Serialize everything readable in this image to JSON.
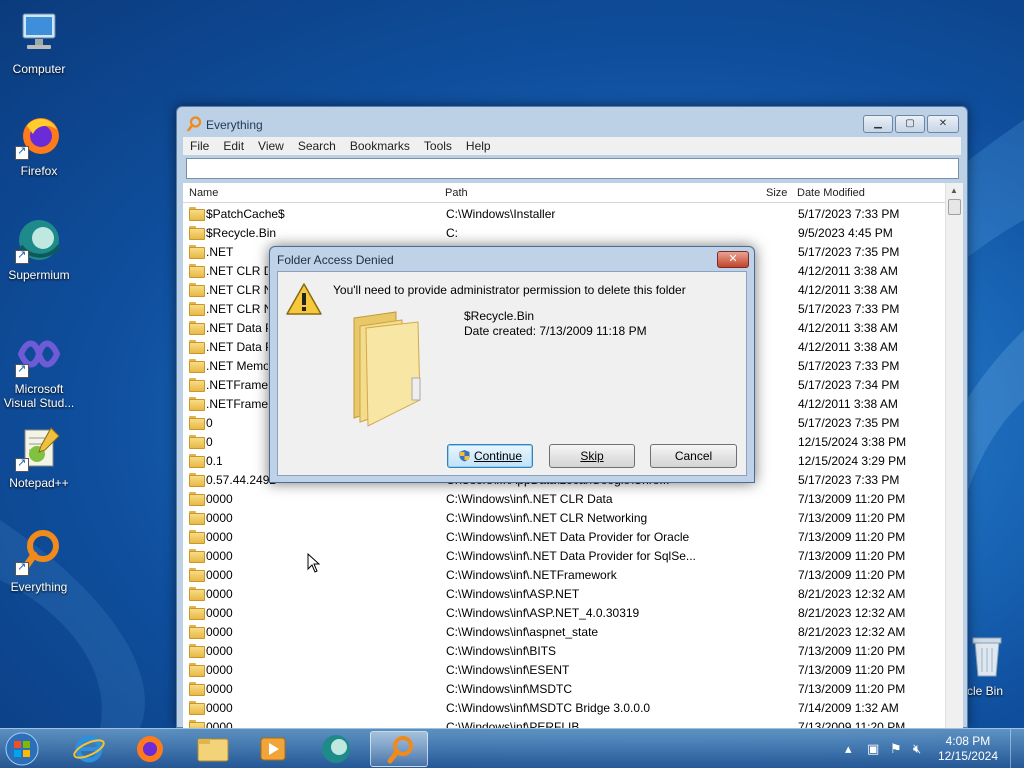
{
  "desktop": {
    "icons": [
      {
        "label": "Computer"
      },
      {
        "label": "Firefox"
      },
      {
        "label": "Supermium"
      },
      {
        "label": "Microsoft Visual Stud..."
      },
      {
        "label": "Notepad++"
      },
      {
        "label": "Everything"
      },
      {
        "label": "cle Bin"
      }
    ]
  },
  "window": {
    "title": "Everything",
    "menu": [
      "File",
      "Edit",
      "View",
      "Search",
      "Bookmarks",
      "Tools",
      "Help"
    ],
    "search_value": "",
    "columns": {
      "name": "Name",
      "path": "Path",
      "size": "Size",
      "date": "Date Modified"
    },
    "rows": [
      {
        "name": "$PatchCache$",
        "path": "C:\\Windows\\Installer",
        "date": "5/17/2023 7:33 PM"
      },
      {
        "name": "$Recycle.Bin",
        "path": "C:",
        "date": "9/5/2023 4:45 PM"
      },
      {
        "name": ".NET",
        "path": "",
        "date": "5/17/2023 7:35 PM"
      },
      {
        "name": ".NET CLR Da",
        "path": "",
        "date": "4/12/2011 3:38 AM"
      },
      {
        "name": ".NET CLR Ne",
        "path": "",
        "date": "4/12/2011 3:38 AM"
      },
      {
        "name": ".NET CLR Ne",
        "path": "",
        "date": "5/17/2023 7:33 PM"
      },
      {
        "name": ".NET Data Pr",
        "path": "",
        "date": "4/12/2011 3:38 AM"
      },
      {
        "name": ".NET Data Pr",
        "path": "",
        "date": "4/12/2011 3:38 AM"
      },
      {
        "name": ".NET Memo",
        "path": "",
        "date": "5/17/2023 7:33 PM"
      },
      {
        "name": ".NETFramew",
        "path": "",
        "date": "5/17/2023 7:34 PM"
      },
      {
        "name": ".NETFramew",
        "path": "",
        "date": "4/12/2011 3:38 AM"
      },
      {
        "name": "0",
        "path": "",
        "date": "5/17/2023 7:35 PM"
      },
      {
        "name": "0",
        "path": "",
        "date": "12/15/2024 3:38 PM"
      },
      {
        "name": "0.1",
        "path": "",
        "date": "12/15/2024 3:29 PM"
      },
      {
        "name": "0.57.44.2492",
        "path": "C:\\Users\\...\\AppData\\Local\\Google\\Chro...",
        "date": "5/17/2023 7:33 PM"
      },
      {
        "name": "0000",
        "path": "C:\\Windows\\inf\\.NET CLR Data",
        "date": "7/13/2009 11:20 PM"
      },
      {
        "name": "0000",
        "path": "C:\\Windows\\inf\\.NET CLR Networking",
        "date": "7/13/2009 11:20 PM"
      },
      {
        "name": "0000",
        "path": "C:\\Windows\\inf\\.NET Data Provider for Oracle",
        "date": "7/13/2009 11:20 PM"
      },
      {
        "name": "0000",
        "path": "C:\\Windows\\inf\\.NET Data Provider for SqlSe...",
        "date": "7/13/2009 11:20 PM"
      },
      {
        "name": "0000",
        "path": "C:\\Windows\\inf\\.NETFramework",
        "date": "7/13/2009 11:20 PM"
      },
      {
        "name": "0000",
        "path": "C:\\Windows\\inf\\ASP.NET",
        "date": "8/21/2023 12:32 AM"
      },
      {
        "name": "0000",
        "path": "C:\\Windows\\inf\\ASP.NET_4.0.30319",
        "date": "8/21/2023 12:32 AM"
      },
      {
        "name": "0000",
        "path": "C:\\Windows\\inf\\aspnet_state",
        "date": "8/21/2023 12:32 AM"
      },
      {
        "name": "0000",
        "path": "C:\\Windows\\inf\\BITS",
        "date": "7/13/2009 11:20 PM"
      },
      {
        "name": "0000",
        "path": "C:\\Windows\\inf\\ESENT",
        "date": "7/13/2009 11:20 PM"
      },
      {
        "name": "0000",
        "path": "C:\\Windows\\inf\\MSDTC",
        "date": "7/13/2009 11:20 PM"
      },
      {
        "name": "0000",
        "path": "C:\\Windows\\inf\\MSDTC Bridge 3.0.0.0",
        "date": "7/14/2009 1:32 AM"
      },
      {
        "name": "0000",
        "path": "C:\\Windows\\inf\\PERFLIB",
        "date": "7/13/2009 11:20 PM"
      }
    ]
  },
  "dialog": {
    "title": "Folder Access Denied",
    "close": "✕",
    "message": "You'll need to provide administrator permission to delete this folder",
    "folder_name": "$Recycle.Bin",
    "date_created": "Date created: 7/13/2009 11:18 PM",
    "buttons": {
      "continue": "Continue",
      "skip": "Skip",
      "cancel": "Cancel"
    }
  },
  "taskbar": {
    "time": "4:08 PM",
    "date": "12/15/2024"
  },
  "colors": {
    "accent": "#3c7fb1",
    "desktop": "#1f6fc0"
  }
}
